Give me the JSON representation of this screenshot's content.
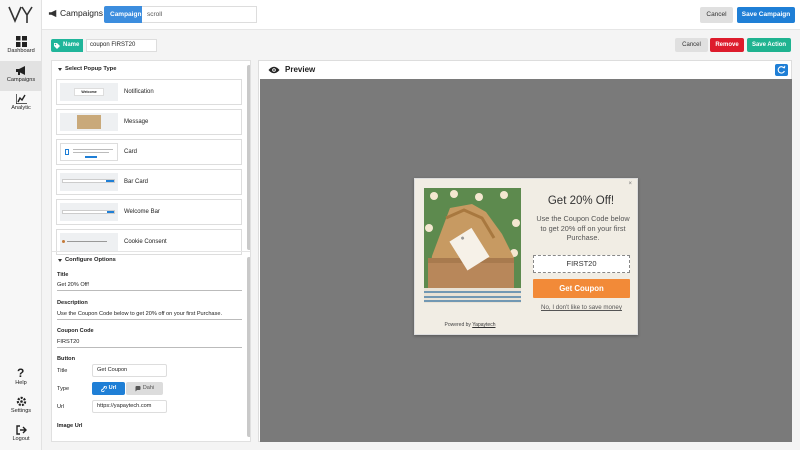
{
  "sidebar": {
    "items": [
      {
        "label": "Dashboard",
        "icon": "dashboard-icon"
      },
      {
        "label": "Campaigns",
        "icon": "megaphone-icon"
      },
      {
        "label": "Analytic",
        "icon": "chart-icon"
      },
      {
        "label": "Help",
        "icon": "question-icon"
      },
      {
        "label": "Settings",
        "icon": "gear-icon"
      },
      {
        "label": "Logout",
        "icon": "logout-icon"
      }
    ]
  },
  "header": {
    "breadcrumb_root": "Campaigns",
    "campaign_tag": "Campaign",
    "campaign_name": "scroll",
    "cancel_label": "Cancel",
    "save_label": "Save Campaign"
  },
  "action": {
    "name_tag": "Name",
    "name_value": "coupon FIRST20",
    "cancel_label": "Cancel",
    "remove_label": "Remove",
    "save_label": "Save Action"
  },
  "popup_types": {
    "heading": "Select Popup Type",
    "items": [
      {
        "label": "Notification",
        "thumb_text": "Welcome"
      },
      {
        "label": "Message"
      },
      {
        "label": "Card"
      },
      {
        "label": "Bar Card"
      },
      {
        "label": "Welcome Bar"
      },
      {
        "label": "Cookie Consent"
      }
    ]
  },
  "config": {
    "heading": "Configure Options",
    "title_label": "Title",
    "title_value": "Get 20% Off!",
    "description_label": "Description",
    "description_value": "Use the Coupon Code below to get 20% off on your first Purchase.",
    "coupon_label": "Coupon Code",
    "coupon_value": "FIRST20",
    "button_label": "Button",
    "btn_title_label": "Title",
    "btn_title_value": "Get Coupon",
    "type_label": "Type",
    "type_url": "Url",
    "type_dahi": "Dahi",
    "url_label": "Url",
    "url_value": "https://yapaytech.com",
    "image_url_label": "Image Url"
  },
  "preview": {
    "heading": "Preview",
    "popup": {
      "close": "×",
      "title": "Get 20% Off!",
      "description": "Use the Coupon Code below to get 20% off on your first Purchase.",
      "code": "FIRST20",
      "button": "Get Coupon",
      "decline": "No, I don't like to save money",
      "powered_prefix": "Powered by",
      "powered_brand": "Yapaytech"
    }
  },
  "colors": {
    "primary": "#1f7fd6",
    "accent_green": "#1fb390",
    "danger": "#dd1c2c",
    "coupon_button": "#f28a38"
  }
}
